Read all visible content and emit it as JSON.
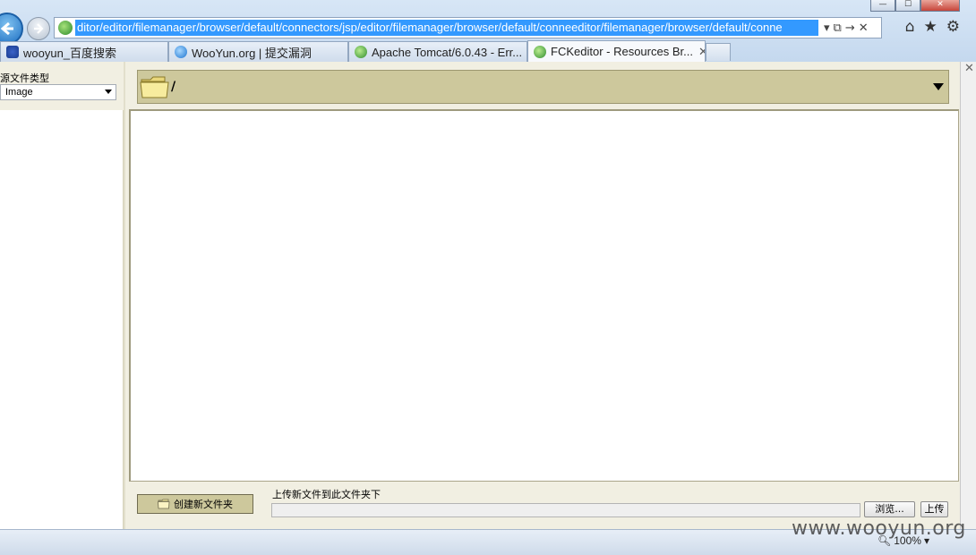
{
  "browser": {
    "window_buttons": [
      "—",
      "☐",
      "✕"
    ],
    "address_url": "ditor/editor/filemanager/browser/default/connectors/jsp/editor/filemanager/browser/default/conneeditor/filemanager/browser/default/conne",
    "tabs": [
      {
        "label": "wooyun_百度搜索",
        "icon": "baidu-paw-icon"
      },
      {
        "label": "WooYun.org | 提交漏洞",
        "icon": "ie-icon"
      },
      {
        "label": "Apache Tomcat/6.0.43 - Err...",
        "icon": "globe-icon"
      },
      {
        "label": "FCKeditor - Resources Br...",
        "icon": "globe-icon",
        "active": true
      }
    ],
    "zoom": "100%"
  },
  "fck": {
    "resource_type_label": "源文件类型",
    "resource_type_value": "Image",
    "current_folder": "/",
    "create_folder_label": "创建新文件夹",
    "upload_label": "上传新文件到此文件夹下",
    "browse_label": "浏览...",
    "upload_button_label": "上传"
  },
  "watermark": "www.wooyun.org",
  "colors": {
    "panel_bg": "#f1efe2",
    "folder_bar": "#cdc89c",
    "url_highlight": "#3399ff"
  }
}
